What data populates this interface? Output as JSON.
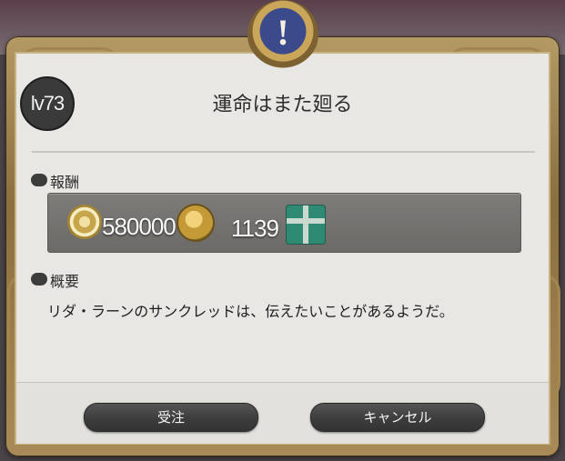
{
  "dialog": {
    "level_badge": "lv73",
    "title": "運命はまた廻る",
    "icon_name": "exclamation-icon"
  },
  "rewards": {
    "section_label": "報酬",
    "gil_amount": "580000",
    "currency_amount": "1139",
    "items": [
      "gil-icon",
      "gold-coin-icon",
      "gift-box-icon"
    ]
  },
  "summary": {
    "section_label": "概要",
    "text": "リダ・ラーンのサンクレッドは、伝えたいことがあるようだ。"
  },
  "buttons": {
    "accept": "受注",
    "cancel": "キャンセル"
  },
  "colors": {
    "frame_gold": "#a88b58",
    "panel_bg": "#e9e7e3",
    "reward_bar": "#74726f",
    "button_dark": "#3d3d3d"
  }
}
